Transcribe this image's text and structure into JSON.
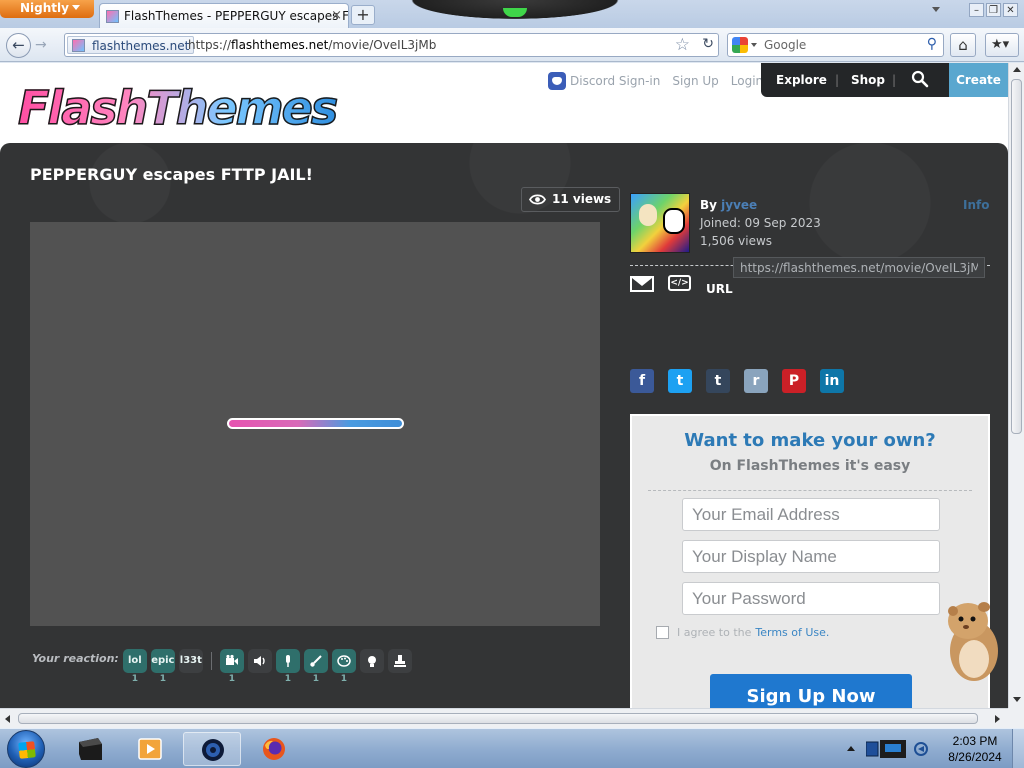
{
  "browser": {
    "app_button": "Nightly",
    "tab_title": "FlashThemes - PEPPERGUY escapes FTT...",
    "new_tab": "+",
    "identity": "flashthemes.net",
    "url_prefix": "https://",
    "url_host": "flashthemes.net",
    "url_path": "/movie/OveIL3jMb",
    "search_placeholder": "Google"
  },
  "site": {
    "logo": "FlashThemes",
    "top_links": {
      "discord": "Discord Sign-in",
      "signup": "Sign Up",
      "login": "Login"
    },
    "nav": {
      "explore": "Explore",
      "sep": "|",
      "shop": "Shop",
      "create": "Create"
    }
  },
  "movie": {
    "title": "PEPPERGUY escapes FTTP JAIL!",
    "views": "11 views",
    "load_progress": 1.0
  },
  "reactions": {
    "label": "Your reaction:",
    "items": [
      {
        "text": "lol",
        "count": "1"
      },
      {
        "text": "epic",
        "count": "1"
      },
      {
        "text": "l33t",
        "count": ""
      },
      {
        "text": "",
        "count": "1"
      },
      {
        "text": "",
        "count": ""
      },
      {
        "text": "",
        "count": "1"
      },
      {
        "text": "",
        "count": "1"
      },
      {
        "text": "",
        "count": "1"
      },
      {
        "text": "",
        "count": ""
      },
      {
        "text": "",
        "count": ""
      }
    ]
  },
  "author": {
    "by": "By",
    "name": "jyvee",
    "joined": "Joined: 09 Sep 2023",
    "views": "1,506 views",
    "info": "Info"
  },
  "share": {
    "embed": "</>",
    "url_label": "URL",
    "url_value": "https://flashthemes.net/movie/OveIL3jMb",
    "networks": [
      {
        "name": "facebook",
        "glyph": "f",
        "color": "#3b5998"
      },
      {
        "name": "twitter",
        "glyph": "t",
        "color": "#1da1f2"
      },
      {
        "name": "tumblr",
        "glyph": "t",
        "color": "#35465c"
      },
      {
        "name": "reddit",
        "glyph": "r",
        "color": "#8aa4bd"
      },
      {
        "name": "pinterest",
        "glyph": "P",
        "color": "#cb2027"
      },
      {
        "name": "linkedin",
        "glyph": "in",
        "color": "#0e76a8"
      }
    ]
  },
  "signup": {
    "heading": "Want to make your own?",
    "sub": "On FlashThemes it's easy",
    "email_placeholder": "Your Email Address",
    "name_placeholder": "Your Display Name",
    "password_placeholder": "Your Password",
    "agree_text": "I agree to the",
    "terms": "Terms of Use.",
    "button": "Sign Up Now"
  },
  "taskbar": {
    "time": "2:03 PM",
    "date": "8/26/2024"
  }
}
